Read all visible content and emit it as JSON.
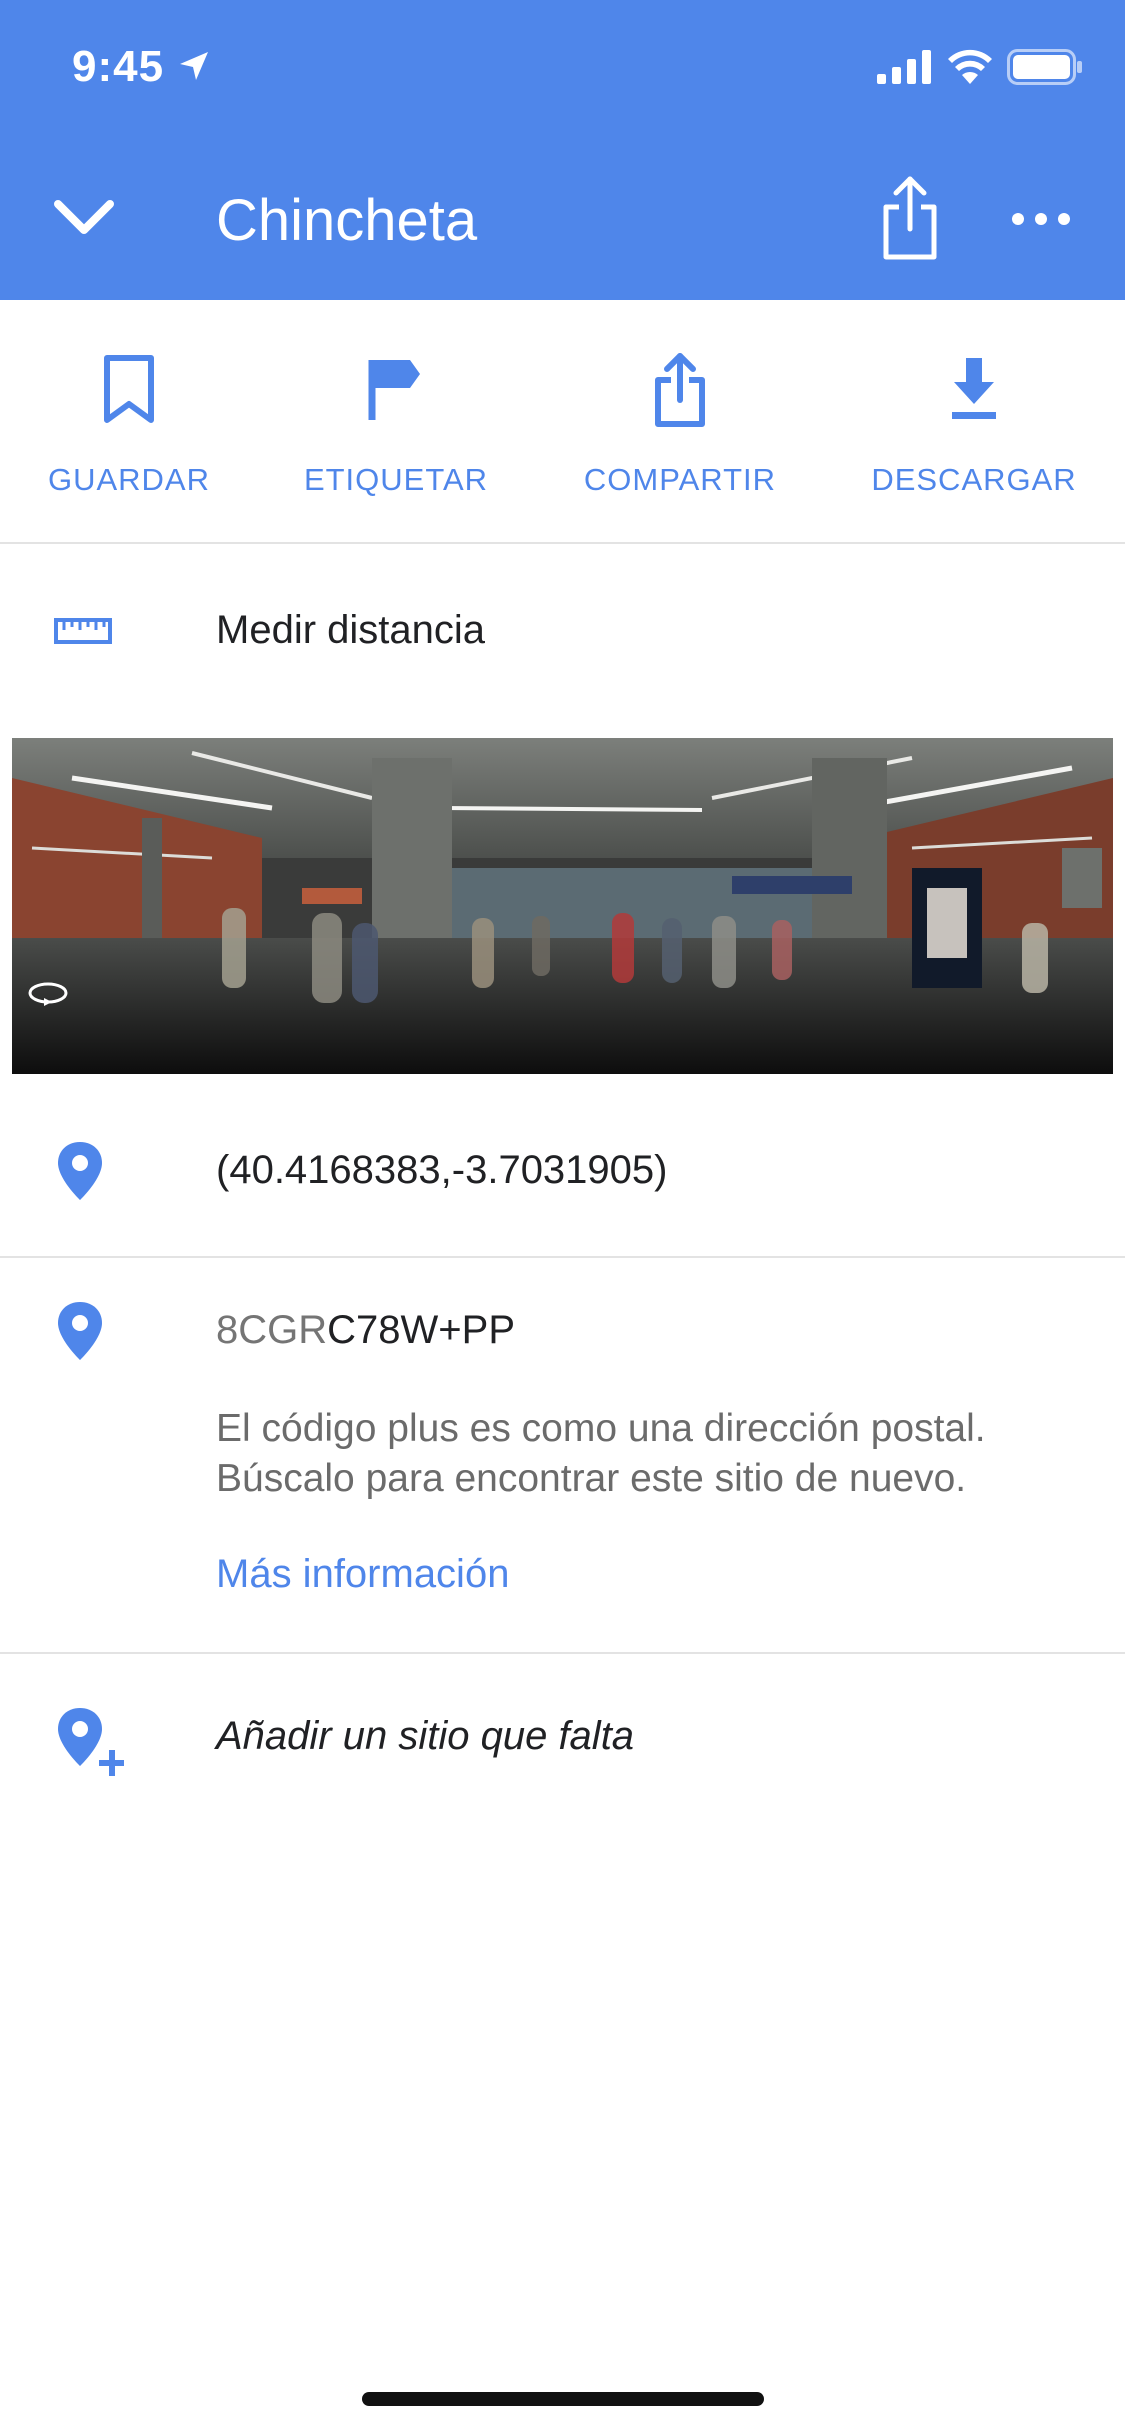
{
  "status_bar": {
    "time": "9:45",
    "icons": [
      "location-arrow-icon",
      "signal-icon",
      "wifi-icon",
      "battery-icon"
    ]
  },
  "header": {
    "title": "Chincheta",
    "background_color": "#4f86ea",
    "icons": [
      "chevron-down-icon",
      "share-icon",
      "more-icon"
    ]
  },
  "actions": [
    {
      "label": "GUARDAR",
      "icon": "bookmark-icon"
    },
    {
      "label": "ETIQUETAR",
      "icon": "flag-icon"
    },
    {
      "label": "COMPARTIR",
      "icon": "share-icon"
    },
    {
      "label": "DESCARGAR",
      "icon": "download-icon"
    }
  ],
  "measure": {
    "label": "Medir distancia",
    "icon": "ruler-icon"
  },
  "panorama": {
    "icon": "360-rotate-icon"
  },
  "coordinates": {
    "text": "(40.4168383,-3.7031905)",
    "icon": "pin-icon"
  },
  "plus_code": {
    "prefix": "8CGR",
    "code": "C78W+PP",
    "description_line1": "El código plus es como una dirección postal.",
    "description_line2": "Búscalo para encontrar este sitio de nuevo.",
    "link": "Más información",
    "icon": "pin-icon"
  },
  "add_place": {
    "label": "Añadir un sitio que falta",
    "icon": "add-location-icon"
  },
  "colors": {
    "accent": "#4f86ea",
    "text": "#202124",
    "secondary_text": "#6b6b6b",
    "divider": "#e3e3e3"
  }
}
